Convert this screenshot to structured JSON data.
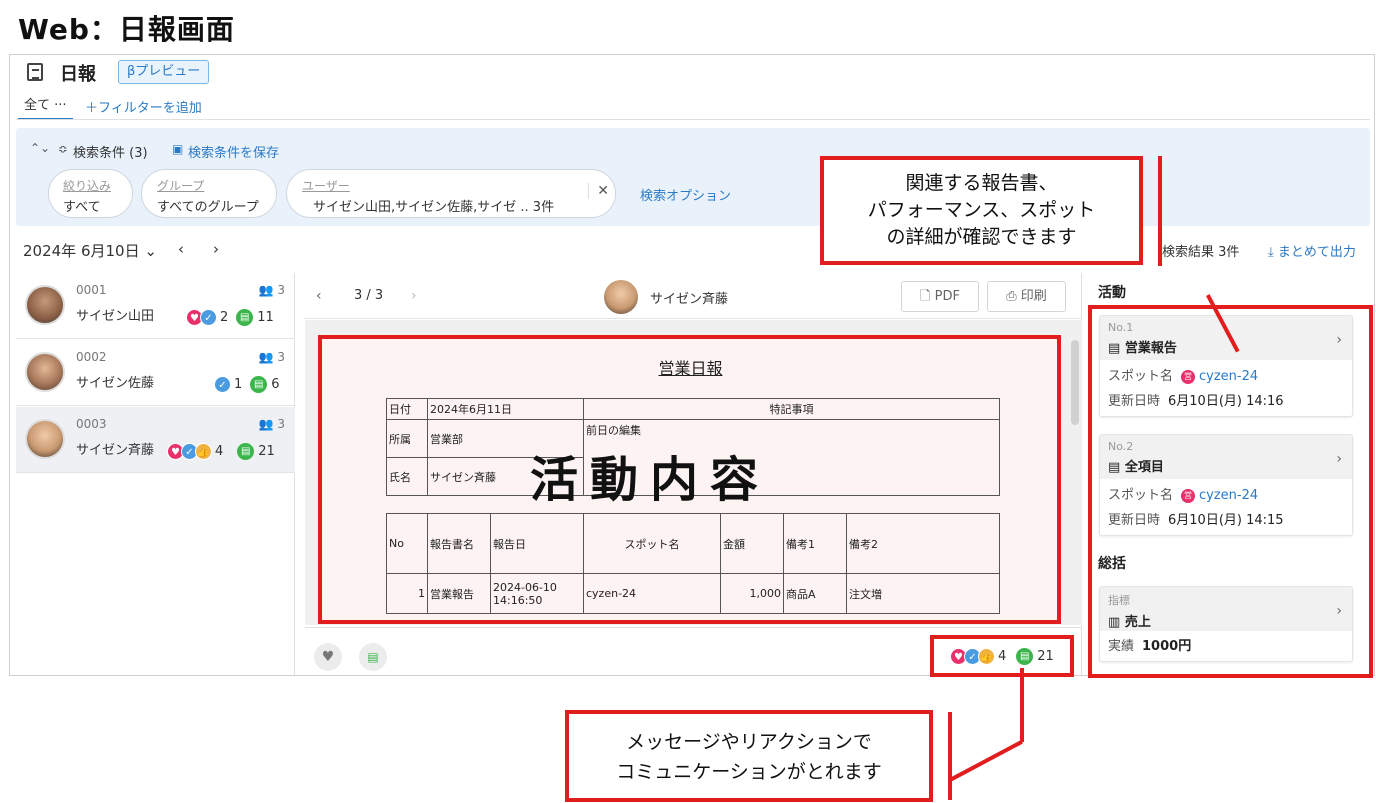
{
  "page_heading": "Web：日報画面",
  "header": {
    "title": "日報",
    "badge": "βプレビュー",
    "tab_all": "全て ···",
    "add_filter": "＋フィルターを追加"
  },
  "search": {
    "conditions_label": "検索条件 (3)",
    "save_label": "検索条件を保存",
    "pills": [
      {
        "label": "絞り込み",
        "value": "すべて"
      },
      {
        "label": "グループ",
        "value": "すべてのグループ"
      },
      {
        "label": "ユーザー",
        "value": "サイゼン山田,サイゼン佐藤,サイゼ .. 3件"
      }
    ],
    "options_link": "検索オプション"
  },
  "date_bar": {
    "date": "2024年 6月10日",
    "result": "検索結果 3件",
    "export": "まとめて出力"
  },
  "reports": [
    {
      "num": "0001",
      "name": "サイゼン山田",
      "group_count": "3",
      "reactions": [
        "heart",
        "check"
      ],
      "reaction_count": "2",
      "comment_count": "11"
    },
    {
      "num": "0002",
      "name": "サイゼン佐藤",
      "group_count": "3",
      "reactions": [
        "check"
      ],
      "reaction_count": "1",
      "comment_count": "6"
    },
    {
      "num": "0003",
      "name": "サイゼン斉藤",
      "group_count": "3",
      "reactions": [
        "heart",
        "check",
        "thumb"
      ],
      "reaction_count": "4",
      "comment_count": "21"
    }
  ],
  "viewer": {
    "page": "3 / 3",
    "user": "サイゼン斉藤",
    "pdf_label": "PDF",
    "print_label": "印刷",
    "document": {
      "title": "営業日報",
      "meta": {
        "date_label": "日付",
        "date_value": "2024年6月11日",
        "dept_label": "所属",
        "dept_value": "営業部",
        "name_label": "氏名",
        "name_value": "サイゼン斉藤",
        "notes_label": "特記事項",
        "notes_sub": "前日の編集"
      },
      "columns": [
        "No",
        "報告書名",
        "報告日",
        "スポット名",
        "金額",
        "備考1",
        "備考2"
      ],
      "rows": [
        [
          "1",
          "営業報告",
          "2024-06-10 14:16:50",
          "cyzen-24",
          "1,000",
          "商品A",
          "注文増"
        ]
      ]
    },
    "overlay": "活動内容",
    "footer": {
      "reaction_count": "4",
      "comment_count": "21"
    }
  },
  "sidebar": {
    "activity_title": "活動",
    "activities": [
      {
        "no": "No.1",
        "title": "営業報告",
        "spot_label": "スポット名",
        "spot_value": "cyzen-24",
        "updated_label": "更新日時",
        "updated_value": "6月10日(月) 14:16"
      },
      {
        "no": "No.2",
        "title": "全項目",
        "spot_label": "スポット名",
        "spot_value": "cyzen-24",
        "updated_label": "更新日時",
        "updated_value": "6月10日(月) 14:15"
      }
    ],
    "summary_title": "総括",
    "summary": {
      "label": "指標",
      "title": "売上",
      "actual_label": "実績",
      "actual_value": "1000円"
    }
  },
  "callouts": {
    "top": [
      "関連する報告書、",
      "パフォーマンス、スポット",
      "の詳細が確認できます"
    ],
    "bottom": [
      "メッセージやリアクションで",
      "コミュニケーションがとれます"
    ]
  },
  "colors": {
    "accent": "#2a7ac6",
    "highlight": "#e11d1d",
    "heart": "#e8306a",
    "check": "#4a9be0",
    "thumb": "#f0b240",
    "comment": "#3cb64c"
  }
}
